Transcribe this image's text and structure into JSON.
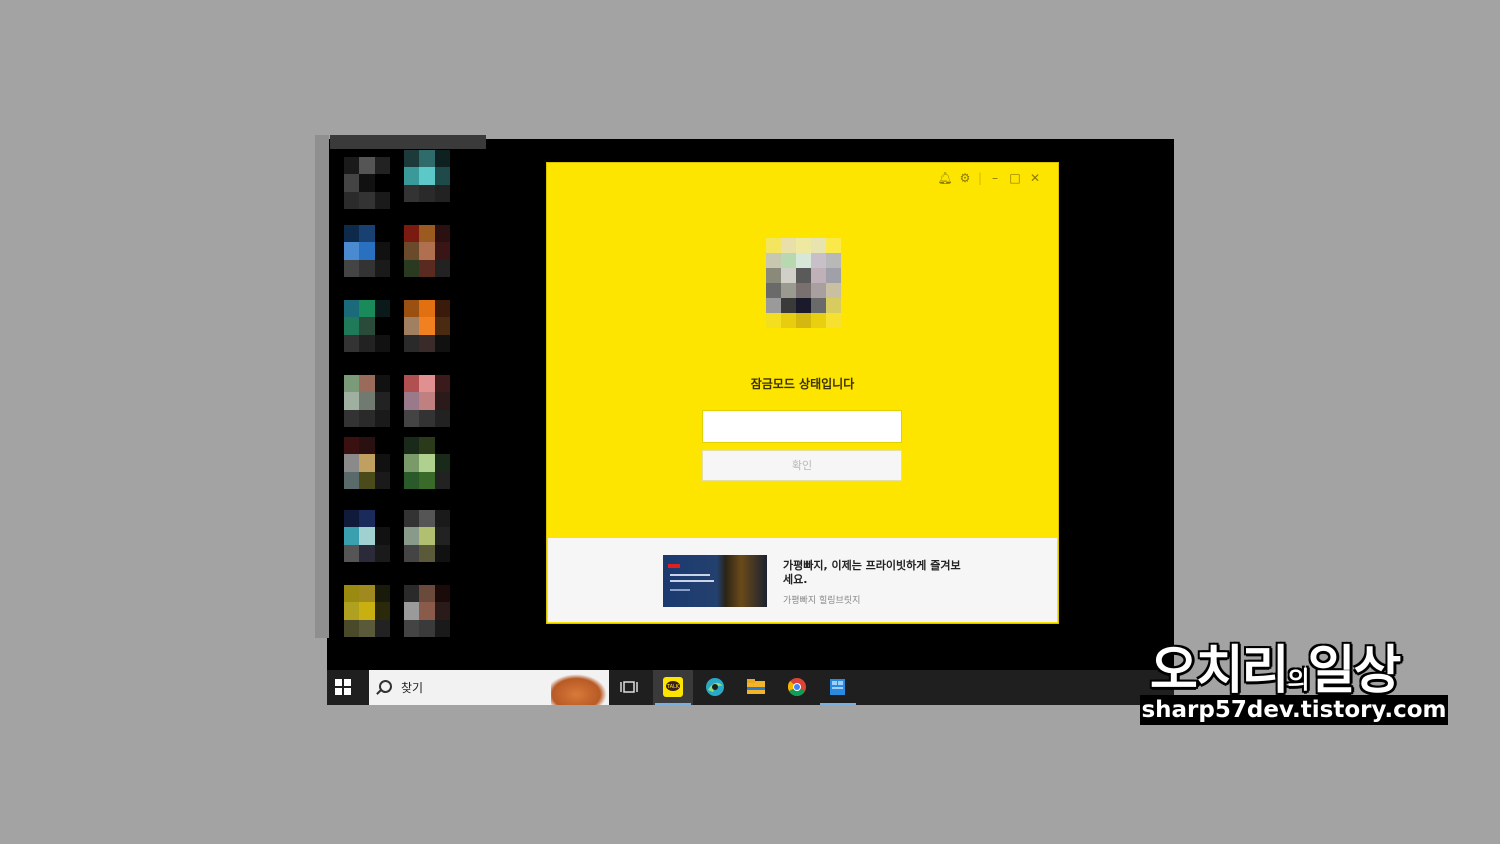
{
  "kakao": {
    "lock_title": "잠금모드 상태입니다",
    "password_value": "",
    "confirm_label": "확인",
    "ad": {
      "headline": "가평빠지, 이제는 프라이빗하게 즐겨보세요.",
      "sub": "가평빠지 힐링브릿지"
    }
  },
  "taskbar": {
    "search_label": "찾기",
    "apps": [
      "task-view-icon",
      "kakaotalk-icon",
      "edge-icon",
      "file-explorer-icon",
      "chrome-icon",
      "app-icon"
    ]
  },
  "watermark": {
    "title_a": "오치리",
    "title_b": "의",
    "title_c": "일상",
    "url": "sharp57dev.tistory.com"
  },
  "colors": {
    "kakao_yellow": "#fee500",
    "taskbar": "#1f1f1f",
    "background": "#a3a3a3"
  }
}
